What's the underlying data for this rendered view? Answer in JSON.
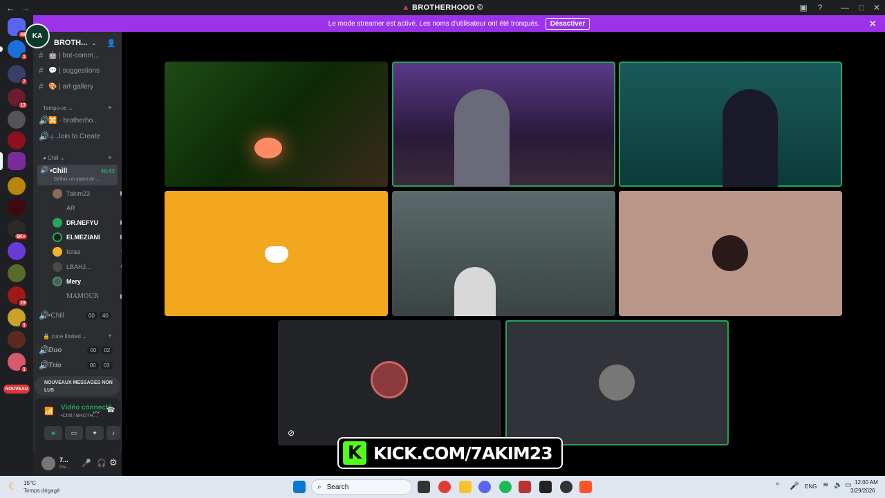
{
  "titlebar": {
    "title": "BROTHERHOOD ©",
    "back": "←",
    "forward": "→"
  },
  "banner": {
    "text": "Le mode streamer est activé. Les noms d'utilisateur ont été tronqués.",
    "button": "Désactiver"
  },
  "servers": {
    "dm_badge": "49",
    "badges": [
      "1",
      "7",
      "13",
      "5K+",
      "19",
      "1",
      "1"
    ],
    "nouveau": "NOUVEAU"
  },
  "sidebar": {
    "server_name": "BROTH...",
    "channels": [
      {
        "name": "bot-comm..."
      },
      {
        "name": "suggestions"
      },
      {
        "name": "art-gallery"
      }
    ],
    "cat_tempo": "Tempo-vc",
    "ch_brotherho": "brotherho...",
    "ch_join": "Join to Create",
    "cat_chill": "Chill",
    "active_voice": {
      "name": "•Chill",
      "time": "46:43",
      "status": "Définir un statut de ..."
    },
    "voice_users": [
      {
        "name": "7akim23"
      },
      {
        "name": "AR"
      },
      {
        "name": "DR.NEFYU"
      },
      {
        "name": "ELMEZIANI"
      },
      {
        "name": "Israa"
      },
      {
        "name": "LBAHJ..."
      },
      {
        "name": "Mery"
      },
      {
        "name": "MAMOUR"
      }
    ],
    "chill2": {
      "name": "•Chill",
      "a": "00",
      "b": "40"
    },
    "cat_zone": "zone limited",
    "duo": {
      "name": "Duo",
      "a": "00",
      "b": "02"
    },
    "trio": {
      "name": "Trio",
      "a": "00",
      "b": "03"
    },
    "new_messages": "NOUVEAUX MESSAGES NON LUS",
    "voice_panel": {
      "title": "Vidéo connecté",
      "sub": "•Chill / BROTH..."
    },
    "user_panel": {
      "name": "7...",
      "status": "Inv..."
    }
  },
  "stream": {
    "kick": "KICK.COM/7AKIM23"
  },
  "taskbar": {
    "temp": "15°C",
    "weather": "Temps dégagé",
    "search": "Search",
    "lang": "ENG",
    "time": "12:00 AM",
    "date": "3/29/2026"
  }
}
